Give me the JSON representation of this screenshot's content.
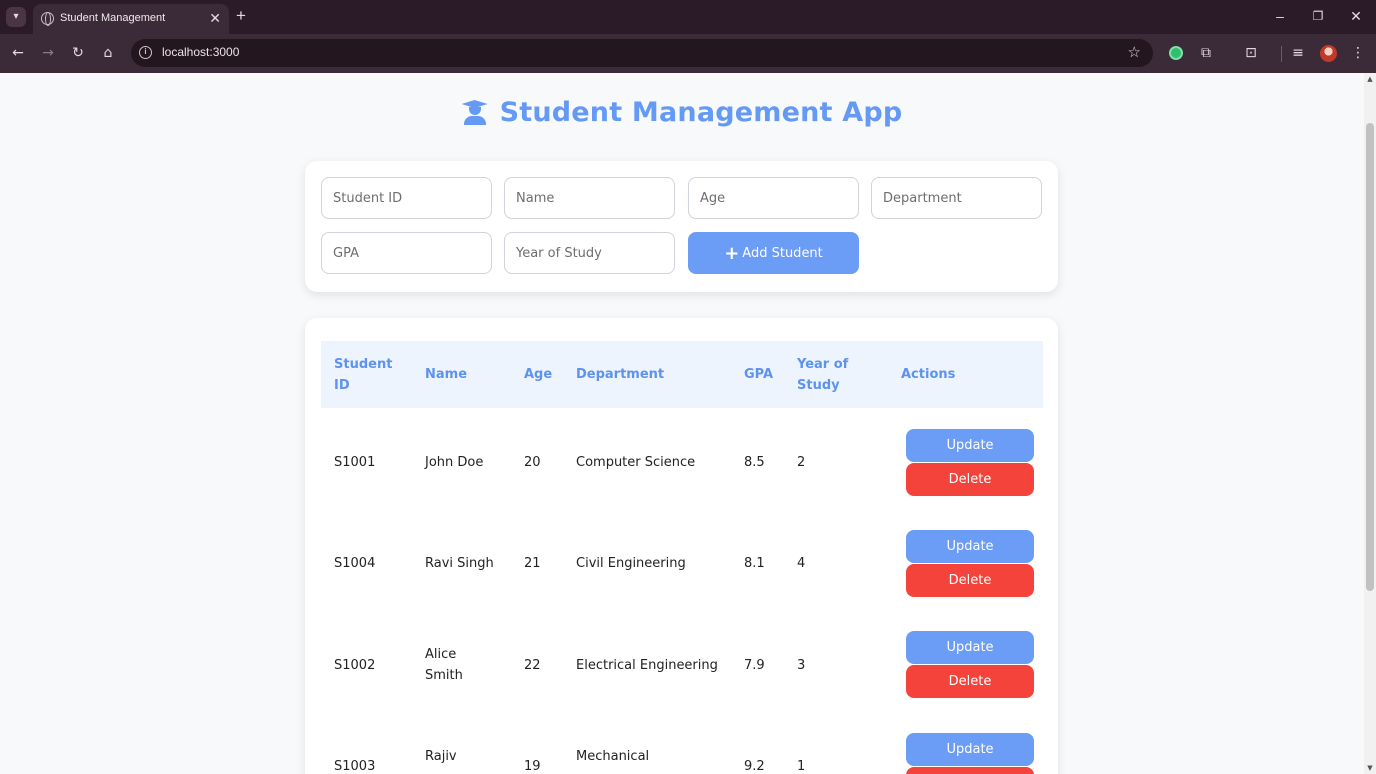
{
  "browser": {
    "tab_title": "Student Management",
    "url": "localhost:3000"
  },
  "app": {
    "title": "Student Management App",
    "title_color": "#6499f4"
  },
  "form": {
    "student_id_placeholder": "Student ID",
    "name_placeholder": "Name",
    "age_placeholder": "Age",
    "department_placeholder": "Department",
    "gpa_placeholder": "GPA",
    "year_placeholder": "Year of Study",
    "add_button": "Add Student"
  },
  "table": {
    "headers": [
      "Student ID",
      "Name",
      "Age",
      "Department",
      "GPA",
      "Year of Study",
      "Actions"
    ],
    "rows": [
      {
        "id": "S1001",
        "name": "John Doe",
        "age": "20",
        "department": "Computer Science",
        "gpa": "8.5",
        "year": "2"
      },
      {
        "id": "S1004",
        "name": "Ravi Singh",
        "age": "21",
        "department": "Civil Engineering",
        "gpa": "8.1",
        "year": "4"
      },
      {
        "id": "S1002",
        "name": "Alice Smith",
        "age": "22",
        "department": "Electrical Engineering",
        "gpa": "7.9",
        "year": "3"
      },
      {
        "id": "S1003",
        "name": "Rajiv",
        "age": "19",
        "department": "Mechanical",
        "gpa": "9.2",
        "year": "1"
      }
    ],
    "update_label": "Update",
    "delete_label": "Delete"
  },
  "colors": {
    "accent": "#6b9cf6",
    "danger": "#f4433a",
    "header_bg": "#eef4fe"
  }
}
